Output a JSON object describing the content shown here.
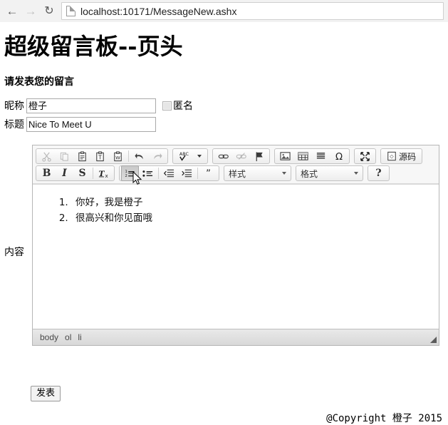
{
  "browser": {
    "back_icon": "arrow-left-icon",
    "forward_icon": "arrow-right-icon",
    "reload_icon": "reload-icon",
    "page_icon": "page-document-icon",
    "url": "localhost:10171/MessageNew.ashx"
  },
  "page": {
    "title": "超级留言板--页头",
    "subtitle": "请发表您的留言",
    "nickname": {
      "label": "昵称",
      "value": "橙子"
    },
    "anonymous": {
      "label": "匿名",
      "checked": false
    },
    "subject": {
      "label": "标题",
      "value": "Nice To Meet U"
    },
    "content_label": "内容",
    "submit_label": "发表",
    "footer": "@Copyright 橙子 2015"
  },
  "editor": {
    "toolbar_row1": [
      {
        "name": "cut",
        "icon": "scissors-icon",
        "state": "disabled"
      },
      {
        "name": "copy",
        "icon": "copy-icon",
        "state": "disabled"
      },
      {
        "name": "paste",
        "icon": "clipboard-icon",
        "state": "enabled"
      },
      {
        "name": "paste-as-plain-text",
        "icon": "clipboard-text-icon",
        "state": "enabled"
      },
      {
        "name": "paste-from-word",
        "icon": "clipboard-word-icon",
        "state": "enabled"
      },
      {
        "name": "undo",
        "icon": "undo-arrow-icon",
        "state": "enabled"
      },
      {
        "name": "redo",
        "icon": "redo-arrow-icon",
        "state": "disabled"
      },
      {
        "name": "spell-check",
        "icon": "abc-check-icon",
        "state": "enabled"
      },
      {
        "name": "link",
        "icon": "chain-link-icon",
        "state": "enabled"
      },
      {
        "name": "unlink",
        "icon": "broken-link-icon",
        "state": "disabled"
      },
      {
        "name": "anchor",
        "icon": "flag-icon",
        "state": "enabled"
      },
      {
        "name": "image",
        "icon": "picture-icon",
        "state": "enabled"
      },
      {
        "name": "table",
        "icon": "table-grid-icon",
        "state": "enabled"
      },
      {
        "name": "horizontal-rule",
        "icon": "horizontal-lines-icon",
        "state": "enabled"
      },
      {
        "name": "special-character",
        "icon": "omega-icon",
        "state": "enabled"
      },
      {
        "name": "maximize",
        "icon": "maximize-arrows-icon",
        "state": "enabled"
      },
      {
        "name": "source",
        "icon": "source-code-icon",
        "state": "enabled"
      }
    ],
    "source_label": "源码",
    "toolbar_row2": [
      {
        "name": "bold",
        "glyph": "B",
        "state": "enabled"
      },
      {
        "name": "italic",
        "glyph": "I",
        "state": "enabled"
      },
      {
        "name": "strike-through",
        "glyph": "S",
        "state": "enabled"
      },
      {
        "name": "remove-format",
        "glyph": "Tx",
        "state": "enabled"
      },
      {
        "name": "numbered-list",
        "icon": "ordered-list-icon",
        "state": "hover"
      },
      {
        "name": "bulleted-list",
        "icon": "unordered-list-icon",
        "state": "enabled"
      },
      {
        "name": "outdent",
        "icon": "outdent-icon",
        "state": "enabled"
      },
      {
        "name": "indent",
        "icon": "indent-icon",
        "state": "enabled"
      },
      {
        "name": "blockquote",
        "icon": "quote-icon",
        "state": "enabled"
      },
      {
        "name": "about",
        "glyph": "?",
        "state": "enabled"
      }
    ],
    "styles_combo": {
      "label": "样式"
    },
    "format_combo": {
      "label": "格式"
    },
    "body_items": [
      "你好，我是橙子",
      "很高兴和你见面哦"
    ],
    "elements_path": [
      "body",
      "ol",
      "li"
    ],
    "resize_handle": "resize-grip-icon"
  },
  "colors": {
    "page_background": "#ffffff",
    "toolbar_background": "#f7f7f7",
    "status_bar": "#e2e2e2",
    "border": "#b6b6b6",
    "text": "#000000"
  }
}
